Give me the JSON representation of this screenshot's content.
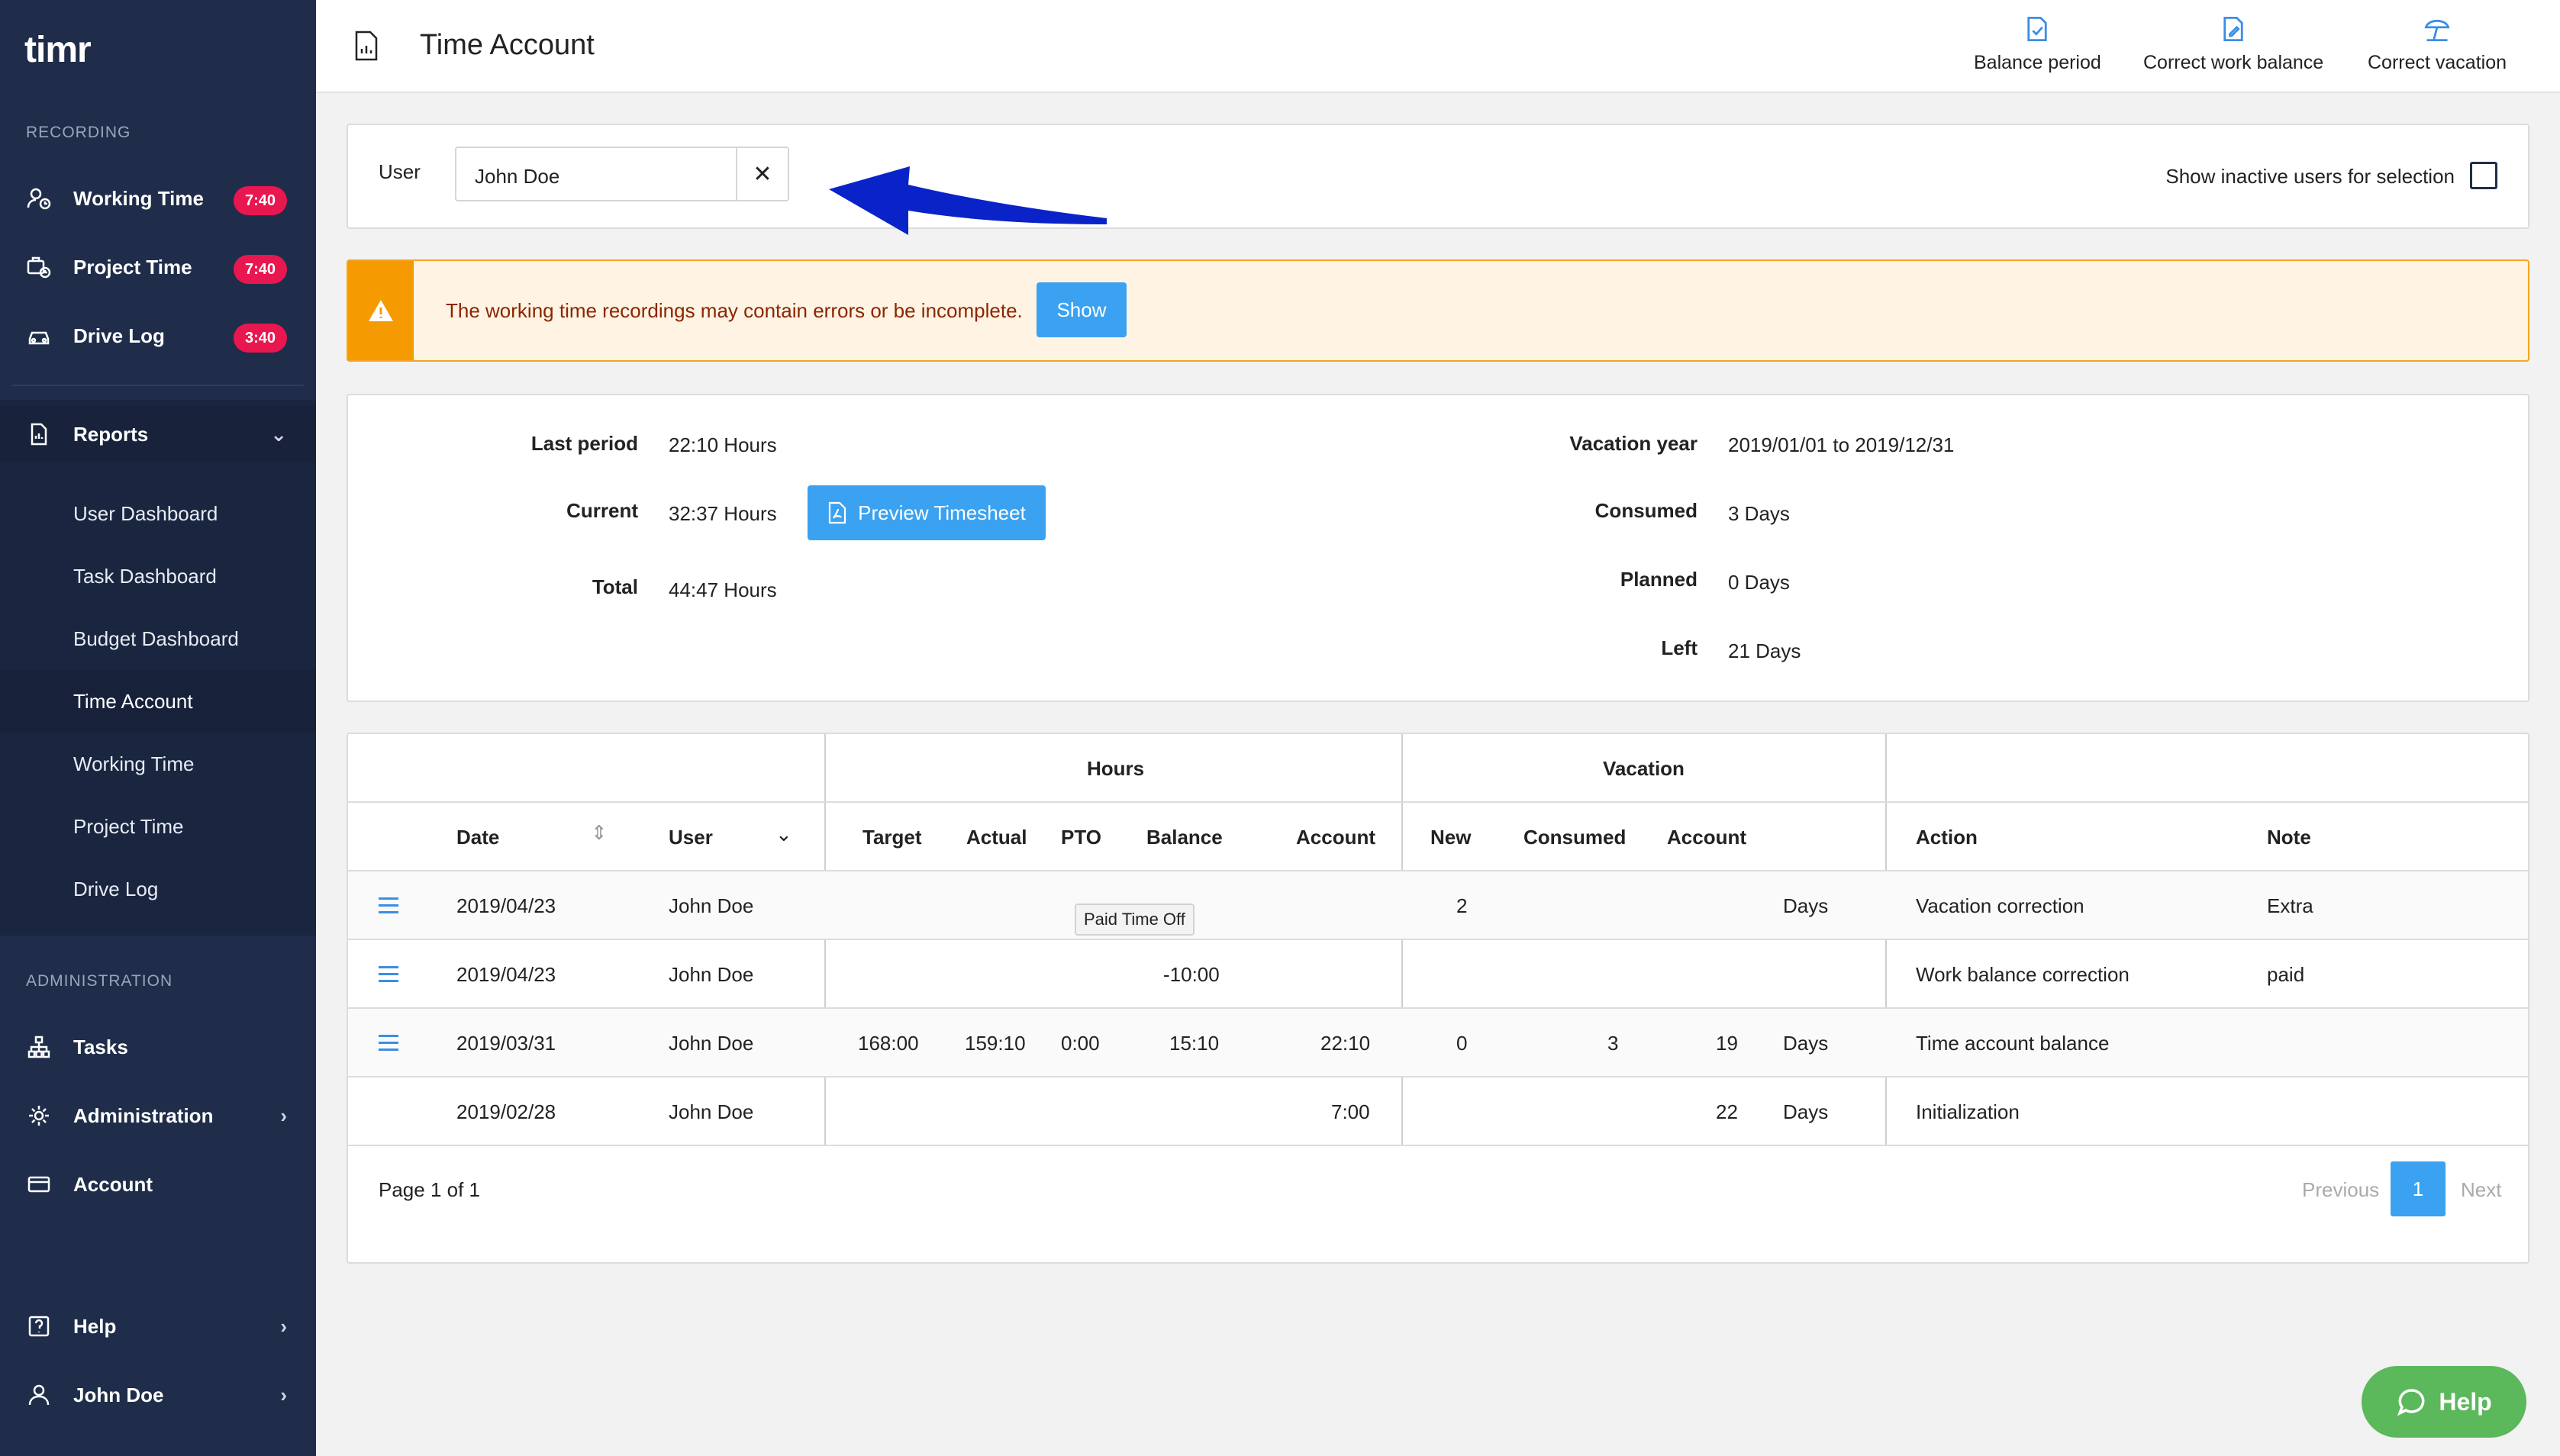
{
  "sidebar": {
    "logo": "timr",
    "recording_label": "RECORDING",
    "recording_items": [
      {
        "label": "Working Time",
        "badge": "7:40"
      },
      {
        "label": "Project Time",
        "badge": "7:40"
      },
      {
        "label": "Drive Log",
        "badge": "3:40"
      }
    ],
    "reports_label": "Reports",
    "report_items": [
      "User Dashboard",
      "Task Dashboard",
      "Budget Dashboard",
      "Time Account",
      "Working Time",
      "Project Time",
      "Drive Log"
    ],
    "admin_label": "ADMINISTRATION",
    "admin_items": [
      "Tasks",
      "Administration",
      "Account"
    ],
    "help_label": "Help",
    "user_label": "John Doe"
  },
  "header": {
    "title": "Time Account",
    "actions": [
      "Balance period",
      "Correct work balance",
      "Correct vacation"
    ]
  },
  "filter": {
    "user_label": "User",
    "user_value": "John Doe",
    "clear_symbol": "✕",
    "inactive_label": "Show inactive users for selection"
  },
  "warning": {
    "text": "The working time recordings may contain errors or be incomplete.",
    "button": "Show"
  },
  "summary": {
    "last_period_label": "Last period",
    "last_period_value": "22:10 Hours",
    "current_label": "Current",
    "current_value": "32:37 Hours",
    "preview_button": "Preview Timesheet",
    "total_label": "Total",
    "total_value": "44:47 Hours",
    "vacation_year_label": "Vacation year",
    "vacation_year_value": "2019/01/01 to 2019/12/31",
    "consumed_label": "Consumed",
    "consumed_value": "3 Days",
    "planned_label": "Planned",
    "planned_value": "0 Days",
    "left_label": "Left",
    "left_value": "21 Days"
  },
  "table": {
    "group_hours": "Hours",
    "group_vacation": "Vacation",
    "headers": {
      "date": "Date",
      "user": "User",
      "target": "Target",
      "actual": "Actual",
      "pto": "PTO",
      "balance": "Balance",
      "account": "Account",
      "new": "New",
      "consumed": "Consumed",
      "vac_account": "Account",
      "action": "Action",
      "note": "Note"
    },
    "tooltip": "Paid Time Off",
    "rows": [
      {
        "date": "2019/04/23",
        "user": "John Doe",
        "target": "",
        "actual": "",
        "pto": "",
        "balance": "",
        "account": "",
        "new": "2",
        "consumed": "",
        "vac_account": "",
        "unit": "Days",
        "action": "Vacation correction",
        "note": "Extra"
      },
      {
        "date": "2019/04/23",
        "user": "John Doe",
        "target": "",
        "actual": "",
        "pto": "",
        "balance": "-10:00",
        "account": "",
        "new": "",
        "consumed": "",
        "vac_account": "",
        "unit": "",
        "action": "Work balance correction",
        "note": "paid"
      },
      {
        "date": "2019/03/31",
        "user": "John Doe",
        "target": "168:00",
        "actual": "159:10",
        "pto": "0:00",
        "balance": "15:10",
        "account": "22:10",
        "new": "0",
        "consumed": "3",
        "vac_account": "19",
        "unit": "Days",
        "action": "Time account balance",
        "note": ""
      },
      {
        "date": "2019/02/28",
        "user": "John Doe",
        "target": "",
        "actual": "",
        "pto": "",
        "balance": "",
        "account": "7:00",
        "new": "",
        "consumed": "",
        "vac_account": "22",
        "unit": "Days",
        "action": "Initialization",
        "note": ""
      }
    ],
    "page_info": "Page 1 of 1",
    "prev": "Previous",
    "next": "Next",
    "current_page": "1"
  },
  "help_button": "Help",
  "colors": {
    "sidebar": "#1f2d4a",
    "badge": "#e8174f",
    "accent": "#3aa2f0",
    "warning": "#f59a00",
    "help": "#5bb85b",
    "arrow": "#0a23c9"
  }
}
